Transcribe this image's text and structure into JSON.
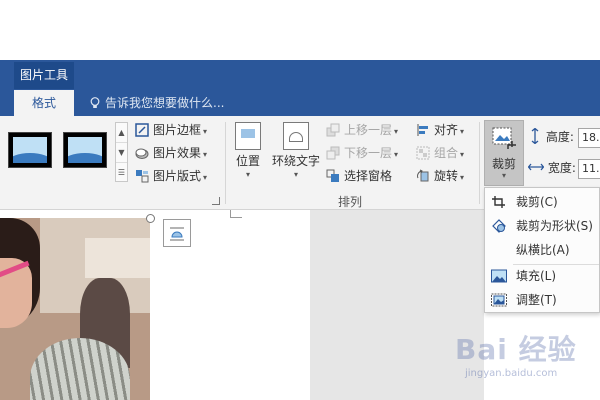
{
  "ribbon_context": {
    "label": "图片工具"
  },
  "tabs": {
    "active": "格式"
  },
  "tell_me": {
    "placeholder": "告诉我您想要做什么..."
  },
  "picture_styles": {
    "commands": [
      "图片边框",
      "图片效果",
      "图片版式"
    ]
  },
  "arrange": {
    "position_label": "位置",
    "wrap_label": "环绕文字",
    "bring_forward": "上移一层",
    "send_backward": "下移一层",
    "selection_pane": "选择窗格",
    "align": "对齐",
    "group": "组合",
    "rotate": "旋转",
    "group_label": "排列"
  },
  "size": {
    "crop_label": "裁剪",
    "height_label": "高度:",
    "height_value": "18.",
    "width_label": "宽度:",
    "width_value": "11."
  },
  "crop_menu": {
    "items": [
      {
        "label": "裁剪(C)",
        "icon": "crop-icon"
      },
      {
        "label": "裁剪为形状(S)",
        "icon": "crop-to-shape-icon"
      },
      {
        "label": "纵横比(A)",
        "icon": ""
      },
      {
        "label": "填充(L)",
        "icon": "fill-icon"
      },
      {
        "label": "调整(T)",
        "icon": "fit-icon"
      }
    ]
  },
  "watermark": {
    "text": "Bai 经验",
    "sub": "jingyan.baidu.com"
  },
  "colors": {
    "accent": "#2b579a",
    "ribbon": "#f3f3f3"
  }
}
